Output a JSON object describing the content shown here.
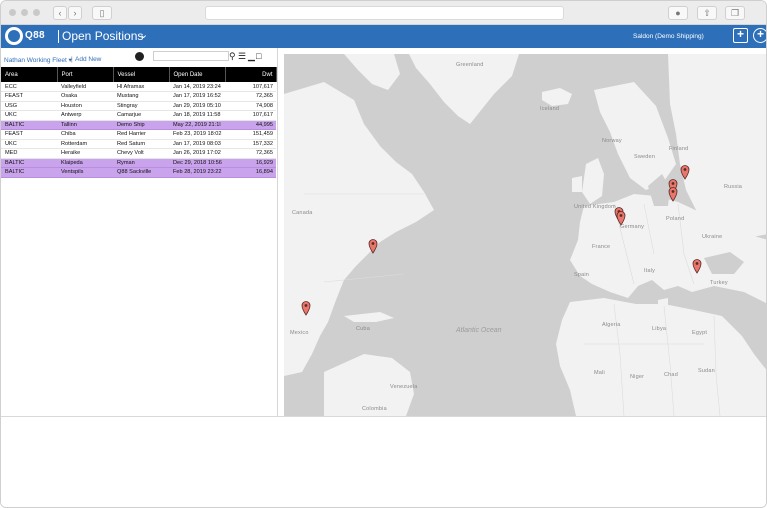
{
  "header": {
    "logo_text": "Q88",
    "title": "Open Positions",
    "account": "Saldon (Demo Shipping)"
  },
  "toolbar": {
    "filter_name": "Nathan Working Fleet",
    "add_new": "Add New",
    "search_placeholder": ""
  },
  "table": {
    "columns": [
      "Area",
      "Port",
      "Vessel",
      "Open Date",
      "Dwt"
    ],
    "rows": [
      {
        "area": "ECC",
        "port": "Valleyfield",
        "vessel": "Hl Aframax",
        "open_date": "Jan 14, 2019 23:24",
        "dwt": "107,617",
        "highlight": false
      },
      {
        "area": "FEAST",
        "port": "Osaka",
        "vessel": "Mustang",
        "open_date": "Jan 17, 2019 16:52",
        "dwt": "72,365",
        "highlight": false
      },
      {
        "area": "USG",
        "port": "Houston",
        "vessel": "Stingray",
        "open_date": "Jan 29, 2019 05:10",
        "dwt": "74,908",
        "highlight": false
      },
      {
        "area": "UKC",
        "port": "Antwerp",
        "vessel": "Camarjue",
        "open_date": "Jan 18, 2019 11:58",
        "dwt": "107,617",
        "highlight": false
      },
      {
        "area": "BALTIC",
        "port": "Tallinn",
        "vessel": "Demo Ship",
        "open_date": "May 22, 2019 21:1l",
        "dwt": "44,995",
        "highlight": true
      },
      {
        "area": "FEAST",
        "port": "Chiba",
        "vessel": "Red Harrier",
        "open_date": "Feb 23, 2019 18:02",
        "dwt": "151,459",
        "highlight": false
      },
      {
        "area": "UKC",
        "port": "Rotterdam",
        "vessel": "Red Saturn",
        "open_date": "Jan 17, 2019 08:03",
        "dwt": "157,332",
        "highlight": false
      },
      {
        "area": "MED",
        "port": "Heraike",
        "vessel": "Chevy Volt",
        "open_date": "Jan 26, 2019 17:02",
        "dwt": "72,365",
        "highlight": false
      },
      {
        "area": "BALTIC",
        "port": "Klaipeda",
        "vessel": "Ryman",
        "open_date": "Dec 29, 2018 10:56",
        "dwt": "16,929",
        "highlight": true
      },
      {
        "area": "BALTIC",
        "port": "Ventspils",
        "vessel": "Q88 Sackville",
        "open_date": "Feb 28, 2019 23:22",
        "dwt": "16,894",
        "highlight": true
      }
    ]
  },
  "map": {
    "land_labels": [
      "Greenland",
      "Iceland",
      "Finland",
      "Sweden",
      "Norway",
      "Germany",
      "Ukraine",
      "Turkey",
      "Egypt",
      "Libya",
      "Algeria",
      "Mali",
      "Niger",
      "Chad",
      "Sudan",
      "Colombia",
      "Venezuela",
      "Cuba",
      "Mexico",
      "Canada",
      "United Kingdom",
      "France",
      "Spain",
      "Italy",
      "Poland",
      "Russia"
    ],
    "ocean_label": "Atlantic Ocean",
    "colors": {
      "land": "#f2f2f2",
      "water": "#cfcfcf",
      "pin": "#e8766b",
      "pin_stroke": "#5a2a26"
    }
  }
}
